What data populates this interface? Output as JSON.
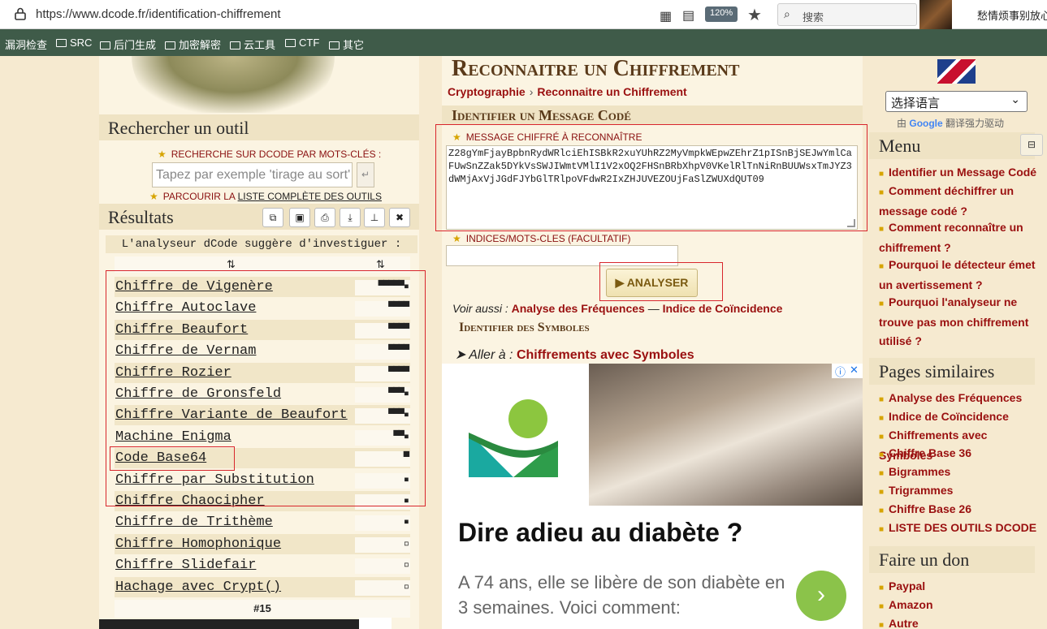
{
  "browser": {
    "url_host": "https://www.dcode.fr",
    "url_path": "/identification-chiffrement",
    "zoom": "120%",
    "search_placeholder": "搜索",
    "news_text": "愁情烦事别放心头"
  },
  "bookmarks": [
    "漏洞检查",
    "SRC",
    "后门生成",
    "加密解密",
    "云工具",
    "CTF",
    "其它"
  ],
  "left": {
    "search_title": "Rechercher un outil",
    "keyword_label": "RECHERCHE SUR DCODE PAR MOTS-CLÉS :",
    "keyword_placeholder": "Tapez par exemple 'tirage au sort'",
    "browse_prefix": "PARCOURIR LA",
    "browse_link": "LISTE COMPLÈTE DES OUTILS",
    "results_title": "Résultats",
    "suggest_text": "L'analyseur dCode suggère d'investiguer :",
    "sort_left": "⇅",
    "sort_right": "⇅",
    "results": [
      {
        "name": "Chiffre de Vigenère",
        "score": "▀▀▀▀▀▪"
      },
      {
        "name": "Chiffre Autoclave",
        "score": "▀▀▀▀"
      },
      {
        "name": "Chiffre Beaufort",
        "score": "▀▀▀▀"
      },
      {
        "name": "Chiffre de Vernam",
        "score": "▀▀▀▀"
      },
      {
        "name": "Chiffre Rozier",
        "score": "▀▀▀▀"
      },
      {
        "name": "Chiffre de Gronsfeld",
        "score": "▀▀▀▪"
      },
      {
        "name": "Chiffre Variante de Beaufort",
        "score": "▀▀▀▪"
      },
      {
        "name": "Machine Enigma",
        "score": "▀▀▪"
      },
      {
        "name": "Code Base64",
        "score": "▀"
      },
      {
        "name": "Chiffre par Substitution",
        "score": "▪"
      },
      {
        "name": "Chiffre Chaocipher",
        "score": "▪"
      },
      {
        "name": "Chiffre de Trithème",
        "score": "▪"
      },
      {
        "name": "Chiffre Homophonique",
        "score": "▫"
      },
      {
        "name": "Chiffre Slidefair",
        "score": "▫"
      },
      {
        "name": "Hachage avec Crypt()",
        "score": "▫"
      }
    ],
    "counter": "#15"
  },
  "center": {
    "title": "Reconnaitre un Chiffrement",
    "crumb_1": "Cryptographie",
    "crumb_sep": "›",
    "crumb_2": "Reconnaitre un Chiffrement",
    "subtitle": "Identifier un Message Codé",
    "message_label": "MESSAGE CHIFFRÉ À RECONNAÎTRE",
    "message_value": "Z28gYmFjayBpbnRydWRlciEhISBkR2xuYUhRZ2MyVmpkWEpwZEhrZ1pISnBjSEJwYmlCaFUwSnZZak5DYkVsSWJIWmtVMlI1V2xOQ2FHSnBRbXhpV0VKelRlTnNiRnBUUWsxTmJYZ3dWMjAxVjJGdFJYbGlTRlpoVFdwR2IxZHJUVEZOUjFaSlZWUXdQUT09",
    "hint_label": "INDICES/MOTS-CLES (FACULTATIF)",
    "analyse_label": "▶ ANALYSER",
    "voir_prefix": "Voir aussi :",
    "voir_link1": "Analyse des Fréquences",
    "voir_sep": "—",
    "voir_link2": "Indice de Coïncidence",
    "symbols_title": "Identifier des Symboles",
    "goto_prefix": "➤ Aller à :",
    "goto_link": "Chiffrements avec Symboles"
  },
  "ad": {
    "headline": "Dire adieu au diabète ?",
    "body": "A 74 ans, elle se libère de son diabète en 3 semaines. Voici comment:",
    "arrow": "›"
  },
  "right": {
    "lang_value": "选择语言",
    "powered_prefix": "由",
    "powered_brand": "Google",
    "powered_suffix": "翻译强力驱动",
    "menu_title": "Menu",
    "menu_items": [
      "Identifier un Message Codé",
      "Comment déchiffrer un message codé ?",
      "Comment reconnaître un chiffrement ?",
      "Pourquoi le détecteur émet un avertissement ?",
      "Pourquoi l'analyseur ne trouve pas mon chiffrement utilisé ?"
    ],
    "similar_title": "Pages similaires",
    "similar_items": [
      "Analyse des Fréquences",
      "Indice de Coïncidence",
      "Chiffrements avec Symboles",
      "Chiffre Base 36",
      "Bigrammes",
      "Trigrammes",
      "Chiffre Base 26",
      "LISTE DES OUTILS DCODE"
    ],
    "donate_title": "Faire un don",
    "donate_items": [
      "Paypal",
      "Amazon",
      "Autre"
    ]
  },
  "colors": {
    "accent_red": "#9a1010",
    "highlight_box": "#d8262c",
    "bookmark_bar": "#3f5b49",
    "page_bg": "#f6ead0"
  }
}
